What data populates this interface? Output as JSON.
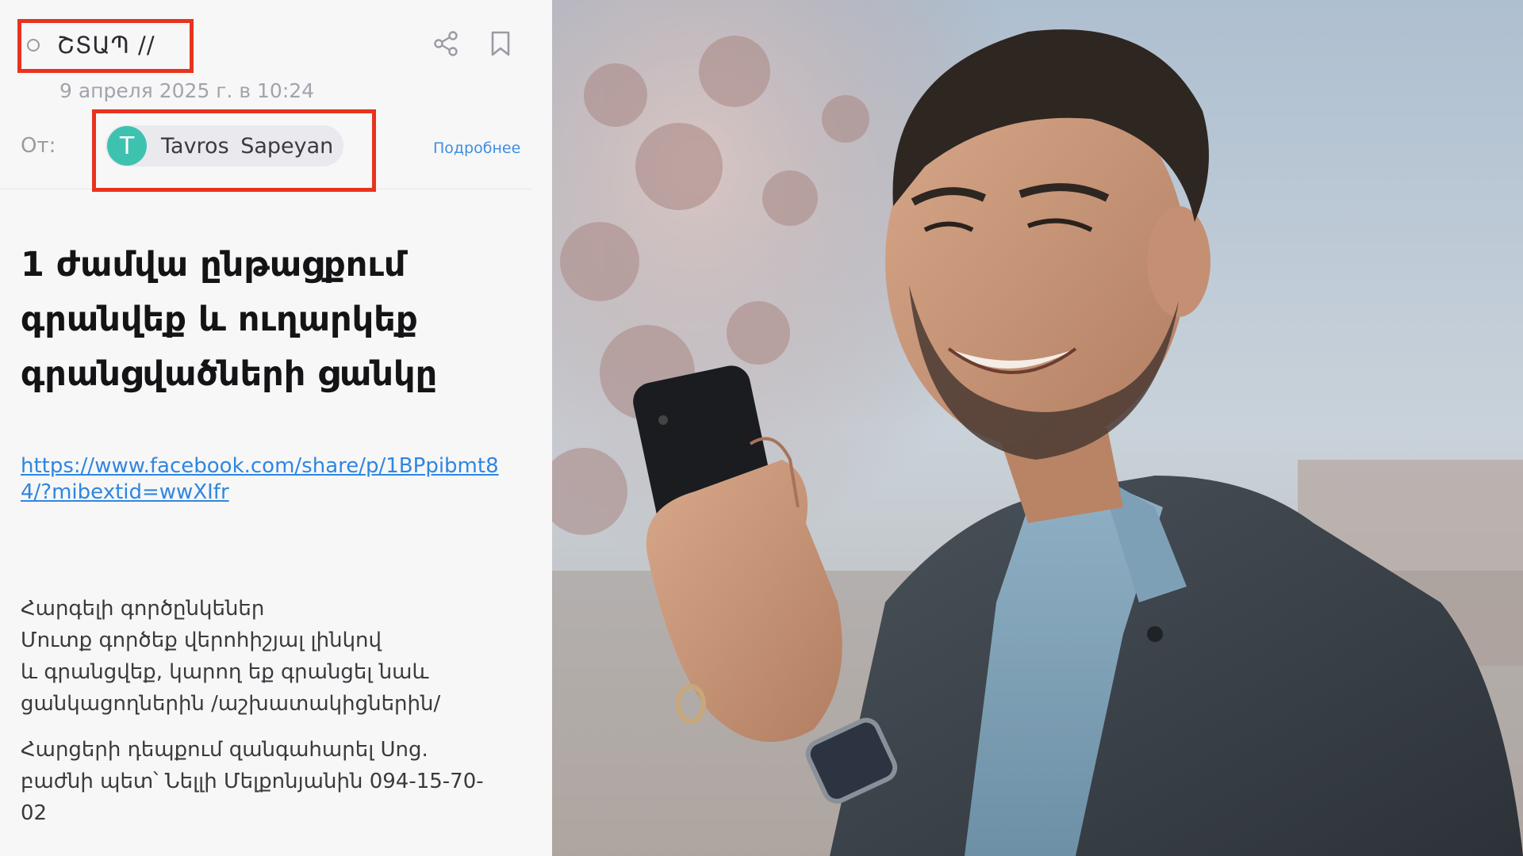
{
  "email": {
    "subject": "ՇՏԱՊ //",
    "date": "9 апреля 2025 г. в 10:24",
    "from_label": "От:",
    "sender": {
      "initial": "T",
      "name": "Tavros  Sapeyan"
    },
    "more_link": "Подробнее",
    "headline": "1 ժամվա ընթացքում գրանվեք և ուղարկեք գրանցվածների ցանկը",
    "link": "https://www.facebook.com/share/p/1BPpibmt84/?mibextid=wwXIfr",
    "paragraph_1": "Հարգելի գործընկեներ\nՄուտք գործեք վերոհիշյալ լինկով\nև գրանցվեք, կարող եք գրանցել նաև\nցանկացողներին /աշխատակիցներին/",
    "paragraph_2": "Հարցերի դեպքում զանգահարել Սոց.\nբաժնի պետ՝ Նելլի Մելքոնյանին 094-15-70-\n02",
    "icons": [
      "search-icon",
      "share-icon",
      "bookmark-icon"
    ]
  },
  "colors": {
    "highlight": "#e8321e",
    "avatar": "#3ec2b0",
    "link": "#2f86e0"
  }
}
